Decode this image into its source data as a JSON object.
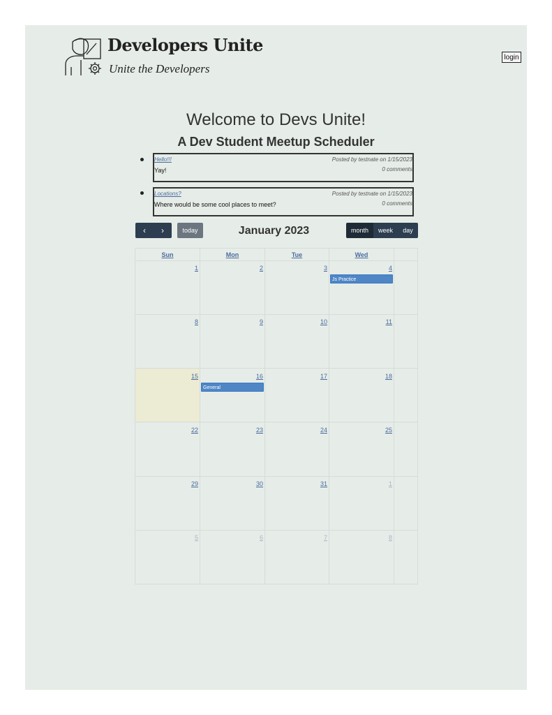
{
  "header": {
    "title": "Developers Unite",
    "tagline": "Unite the Developers",
    "login_label": "login"
  },
  "main": {
    "welcome": "Welcome to Devs Unite!",
    "subtitle": "A Dev Student Meetup Scheduler"
  },
  "posts": [
    {
      "title": "Hello!!!",
      "meta": "Posted by testnate on 1/15/2023",
      "body": "Yay!",
      "comments": "0 comments"
    },
    {
      "title": "Locations?",
      "meta": "Posted by testnate on 1/15/2023",
      "body": "Where would be some cool places to meet?",
      "comments": "0 comments"
    }
  ],
  "calendar": {
    "title": "January 2023",
    "prev_icon": "chevron-left-icon",
    "next_icon": "chevron-right-icon",
    "prev_glyph": "‹",
    "next_glyph": "›",
    "today_label": "today",
    "views": [
      "month",
      "week",
      "day"
    ],
    "active_view": "month",
    "weekdays": [
      "Sun",
      "Mon",
      "Tue",
      "Wed"
    ],
    "weeks": [
      [
        "1",
        "2",
        "3",
        "4"
      ],
      [
        "8",
        "9",
        "10",
        "11"
      ],
      [
        "15",
        "16",
        "17",
        "18"
      ],
      [
        "22",
        "23",
        "24",
        "25"
      ],
      [
        "29",
        "30",
        "31",
        "1"
      ],
      [
        "5",
        "6",
        "7",
        "8"
      ]
    ],
    "events": [
      {
        "label": "Js Practice",
        "date": "Jan 4"
      },
      {
        "label": "General",
        "date": "Jan 16"
      }
    ],
    "today_date": "15",
    "colors": {
      "event": "#4f86c6",
      "today_highlight": "#ecebd3",
      "toolbar": "#2c3e50",
      "link": "#4a6ca0"
    }
  }
}
